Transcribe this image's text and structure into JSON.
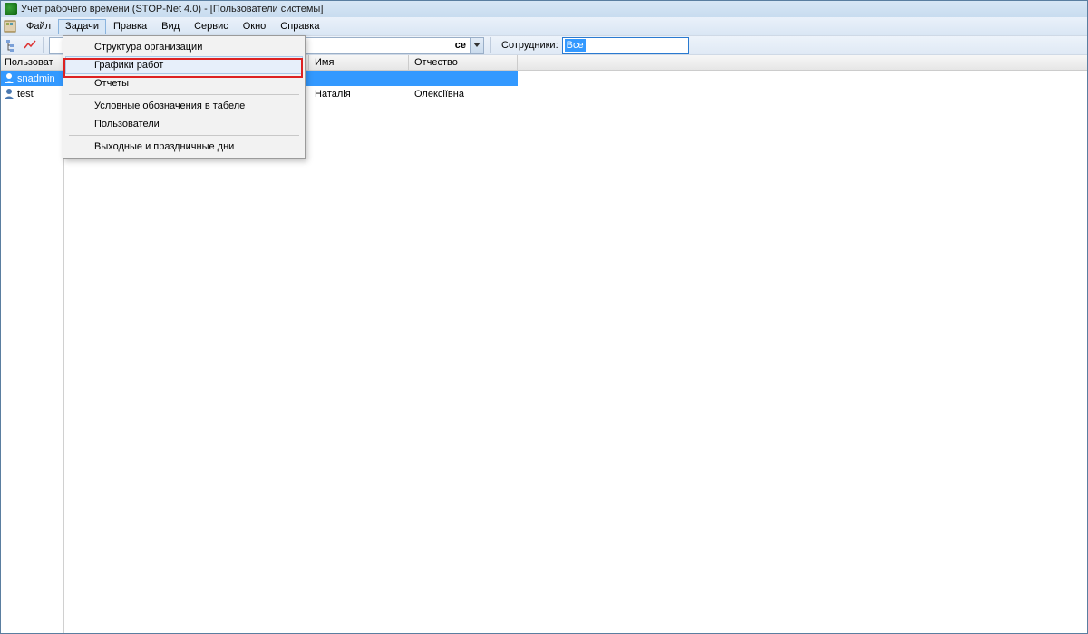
{
  "titlebar": {
    "text": "Учет рабочего времени (STOP-Net 4.0) - [Пользователи системы]"
  },
  "menubar": {
    "items": [
      "Файл",
      "Задачи",
      "Правка",
      "Вид",
      "Сервис",
      "Окно",
      "Справка"
    ],
    "open_index": 1
  },
  "toolbar": {
    "combo_visible_fragment": "се",
    "employees_label": "Сотрудники:",
    "filter_value": "Все"
  },
  "dropdown": {
    "items": [
      "Структура организации",
      "Графики работ",
      "Отчеты",
      "Условные обозначения в табеле",
      "Пользователи",
      "Выходные и праздничные дни"
    ],
    "hover_index": 1,
    "separators_after": [
      2,
      4
    ]
  },
  "left_pane": {
    "header": "Пользоват",
    "rows": [
      {
        "label": "snadmin",
        "selected": true
      },
      {
        "label": "test",
        "selected": false
      }
    ]
  },
  "grid": {
    "headers": [
      "",
      "Имя",
      "Отчество"
    ],
    "rows": [
      {
        "a": "",
        "b": "",
        "c": "",
        "selected": true
      },
      {
        "a": "",
        "b": "Наталія",
        "c": "Олексіївна",
        "selected": false
      }
    ]
  }
}
